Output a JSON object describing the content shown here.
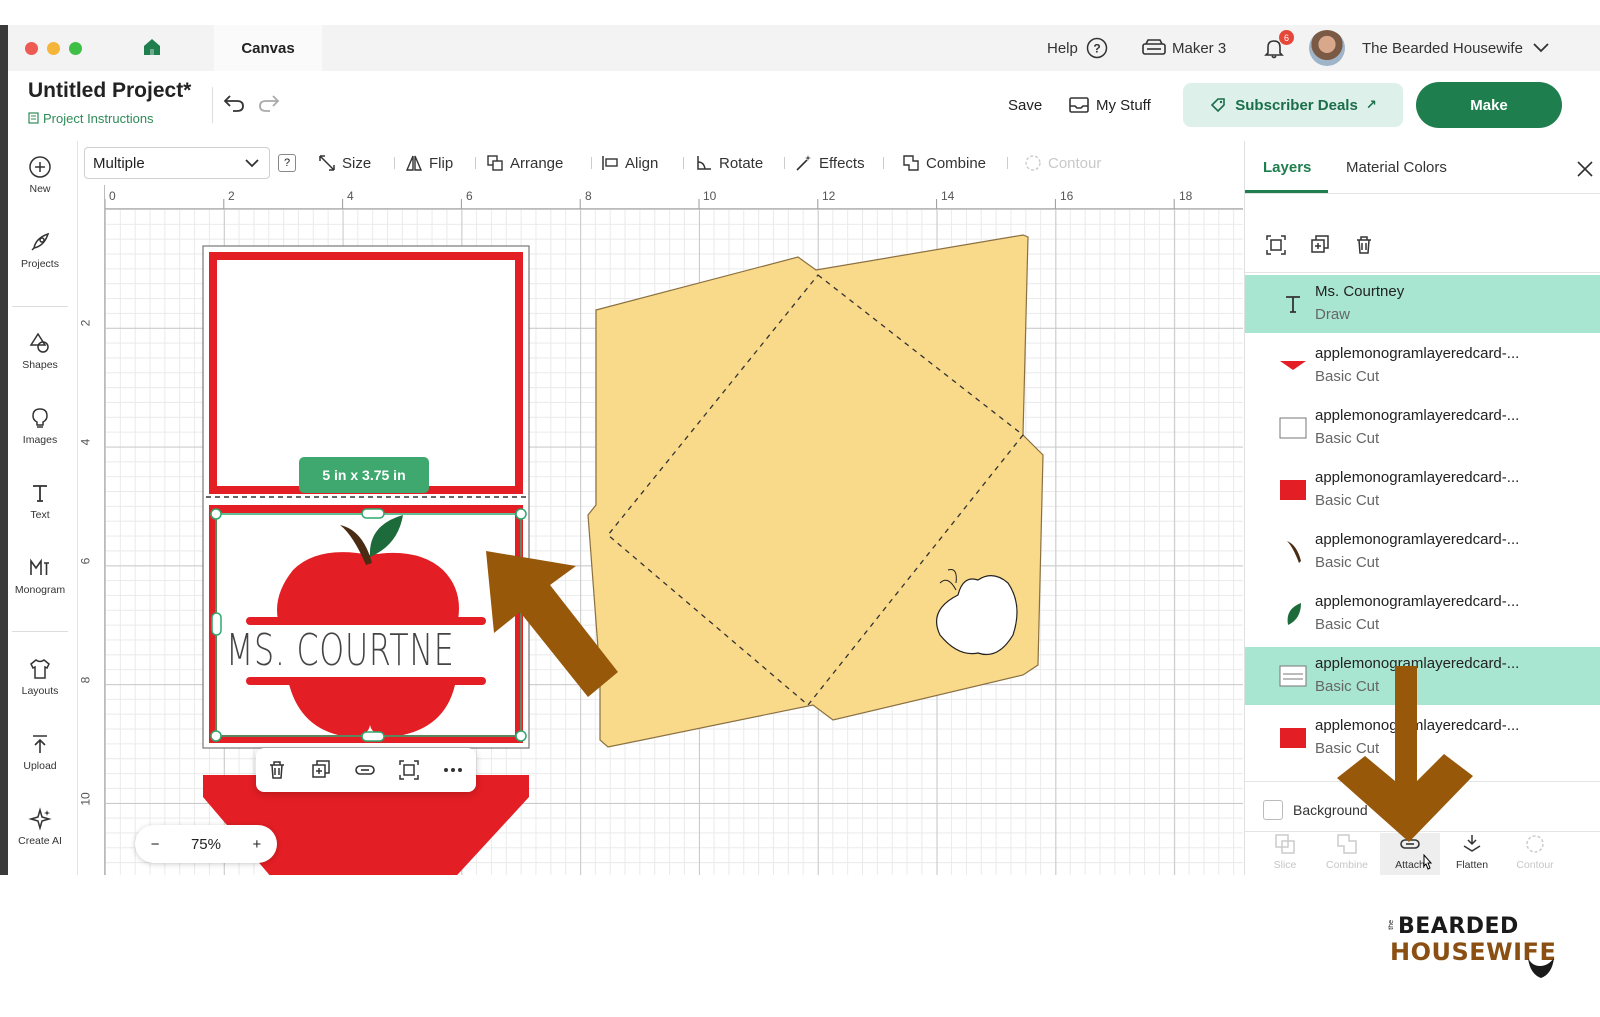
{
  "titlebar": {
    "tab_label": "Canvas",
    "help_label": "Help",
    "machine_label": "Maker 3",
    "notification_count": "6",
    "user_name": "The Bearded Housewife"
  },
  "header": {
    "project_title": "Untitled Project*",
    "project_instructions": "Project Instructions",
    "save_label": "Save",
    "my_stuff_label": "My Stuff",
    "subscriber_deals_label": "Subscriber Deals",
    "make_label": "Make"
  },
  "left_toolbar": {
    "items": [
      {
        "label": "New",
        "icon": "plus-circle-icon"
      },
      {
        "label": "Projects",
        "icon": "rocket-icon"
      },
      {
        "label": "Shapes",
        "icon": "shapes-icon"
      },
      {
        "label": "Images",
        "icon": "lightbulb-icon"
      },
      {
        "label": "Text",
        "icon": "text-icon"
      },
      {
        "label": "Monogram",
        "icon": "monogram-icon"
      },
      {
        "label": "Layouts",
        "icon": "shirt-icon"
      },
      {
        "label": "Upload",
        "icon": "upload-icon"
      },
      {
        "label": "Create AI",
        "icon": "sparkle-icon"
      }
    ]
  },
  "edit_toolbar": {
    "operation_value": "Multiple",
    "help_label": "?",
    "size_label": "Size",
    "flip_label": "Flip",
    "arrange_label": "Arrange",
    "align_label": "Align",
    "rotate_label": "Rotate",
    "effects_label": "Effects",
    "combine_label": "Combine",
    "contour_label": "Contour"
  },
  "canvas": {
    "ruler_top": [
      "0",
      "2",
      "4",
      "6",
      "8",
      "10",
      "12",
      "14",
      "16",
      "18"
    ],
    "ruler_left": [
      "2",
      "4",
      "6",
      "8",
      "10"
    ],
    "dimension_badge": "5 in x 3.75 in",
    "card_text": "MS. COURTNE",
    "zoom_level": "75%",
    "zoom_minus": "−",
    "zoom_plus": "+"
  },
  "right_panel": {
    "tabs": [
      "Layers",
      "Material Colors"
    ],
    "active_tab": "Layers",
    "layers": [
      {
        "name": "Ms. Courtney",
        "operation": "Draw",
        "selected": true,
        "swatch": "text"
      },
      {
        "name": "applemonogramlayeredcard-...",
        "operation": "Basic Cut",
        "selected": false,
        "swatch": "#e31e24"
      },
      {
        "name": "applemonogramlayeredcard-...",
        "operation": "Basic Cut",
        "selected": false,
        "swatch": "#ffffff"
      },
      {
        "name": "applemonogramlayeredcard-...",
        "operation": "Basic Cut",
        "selected": false,
        "swatch": "#e31e24"
      },
      {
        "name": "applemonogramlayeredcard-...",
        "operation": "Basic Cut",
        "selected": false,
        "swatch": "#4a2c14"
      },
      {
        "name": "applemonogramlayeredcard-...",
        "operation": "Basic Cut",
        "selected": false,
        "swatch": "#1d6b3a"
      },
      {
        "name": "applemonogramlayeredcard-...",
        "operation": "Basic Cut",
        "selected": true,
        "swatch": "card"
      },
      {
        "name": "applemonogramlayeredcard-...",
        "operation": "Basic Cut",
        "selected": false,
        "swatch": "#e31e24"
      }
    ],
    "background_label": "Background",
    "bottom_tools": [
      {
        "label": "Slice",
        "active": false
      },
      {
        "label": "Combine",
        "active": false
      },
      {
        "label": "Attach",
        "active": true
      },
      {
        "label": "Flatten",
        "active": true
      },
      {
        "label": "Contour",
        "active": false
      }
    ]
  },
  "watermark": {
    "line1": "BEARDED",
    "line2": "HOUSEWIFE",
    "prefix": "the"
  },
  "colors": {
    "brand_green": "#1e7e4e",
    "selection_teal": "#a8e6d2",
    "envelope_yellow": "#f9d98a",
    "card_red": "#e31e24",
    "annotation_arrow": "#97580a"
  }
}
